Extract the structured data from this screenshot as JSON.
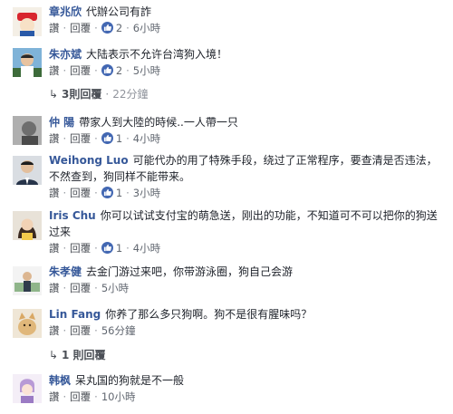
{
  "labels": {
    "like": "讚",
    "reply": "回覆",
    "sep": "·"
  },
  "comments": [
    {
      "author": "章兆欣",
      "text": "代辦公司有詐",
      "likes": "2",
      "time": "6小時"
    },
    {
      "author": "朱亦斌",
      "text": "大陆表示不允许台湾狗入境！",
      "likes": "2",
      "time": "5小時",
      "replies_label": "3則回覆",
      "replies_time": "22分鐘"
    },
    {
      "author": "仲 陽",
      "text": "帶家人到大陸的時候..一人帶一只",
      "likes": "1",
      "time": "4小時"
    },
    {
      "author": "Weihong Luo",
      "text": "可能代办的用了特殊手段，绕过了正常程序，要查清是否违法，不然查到，狗同样不能带来。",
      "likes": "1",
      "time": "3小時"
    },
    {
      "author": "Iris Chu",
      "text": "你可以试试支付宝的萌急送，刚出的功能，不知道可不可以把你的狗送过来",
      "likes": "1",
      "time": "4小時"
    },
    {
      "author": "朱孝健",
      "text": "去金门游过来吧，你带游泳圈，狗自己会游",
      "time": "5小時"
    },
    {
      "author": "Lin Fang",
      "text": "你养了那么多只狗啊。狗不是很有腥味吗？",
      "time": "56分鐘",
      "replies_label": "1 則回覆"
    },
    {
      "author": "韩枫",
      "text": "呆丸国的狗就是不一般",
      "time": "10小時"
    }
  ],
  "colors": {
    "author": "#365899",
    "like_badge": "#4267b2",
    "meta": "#616770"
  }
}
